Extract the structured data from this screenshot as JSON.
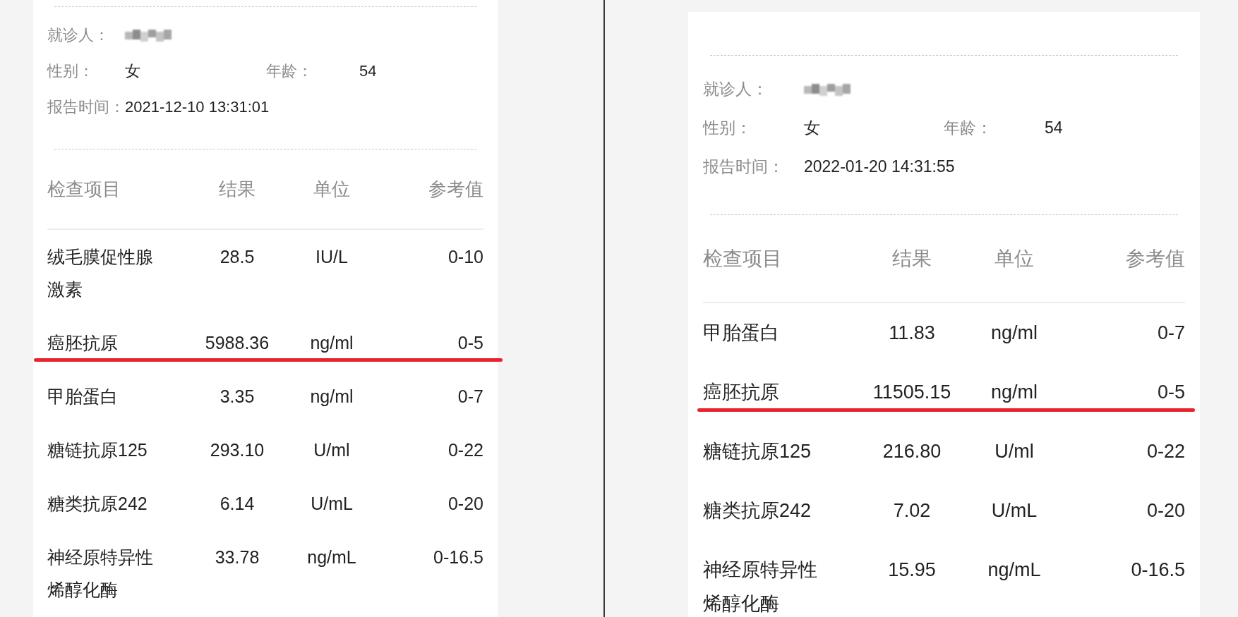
{
  "panels": [
    {
      "patient_label": "就诊人：",
      "sex_label": "性别：",
      "sex": "女",
      "age_label": "年龄：",
      "age": "54",
      "time_label": "报告时间：",
      "time": "2021-12-10 13:31:01",
      "columns": [
        "检查项目",
        "结果",
        "单位",
        "参考值"
      ],
      "rows": [
        {
          "item": "绒毛膜促性腺激素",
          "result": "28.5",
          "unit": "IU/L",
          "reference": "0-10",
          "underlined": false
        },
        {
          "item": "癌胚抗原",
          "result": "5988.36",
          "unit": "ng/ml",
          "reference": "0-5",
          "underlined": true
        },
        {
          "item": "甲胎蛋白",
          "result": "3.35",
          "unit": "ng/ml",
          "reference": "0-7",
          "underlined": false
        },
        {
          "item": "糖链抗原125",
          "result": "293.10",
          "unit": "U/ml",
          "reference": "0-22",
          "underlined": false
        },
        {
          "item": "糖类抗原242",
          "result": "6.14",
          "unit": "U/mL",
          "reference": "0-20",
          "underlined": false
        },
        {
          "item": "神经原特异性烯醇化酶",
          "result": "33.78",
          "unit": "ng/mL",
          "reference": "0-16.5",
          "underlined": false
        }
      ]
    },
    {
      "patient_label": "就诊人：",
      "sex_label": "性别：",
      "sex": "女",
      "age_label": "年龄：",
      "age": "54",
      "time_label": "报告时间：",
      "time": "2022-01-20 14:31:55",
      "columns": [
        "检查项目",
        "结果",
        "单位",
        "参考值"
      ],
      "rows": [
        {
          "item": "甲胎蛋白",
          "result": "11.83",
          "unit": "ng/ml",
          "reference": "0-7",
          "underlined": false
        },
        {
          "item": "癌胚抗原",
          "result": "11505.15",
          "unit": "ng/ml",
          "reference": "0-5",
          "underlined": true
        },
        {
          "item": "糖链抗原125",
          "result": "216.80",
          "unit": "U/ml",
          "reference": "0-22",
          "underlined": false
        },
        {
          "item": "糖类抗原242",
          "result": "7.02",
          "unit": "U/mL",
          "reference": "0-20",
          "underlined": false
        },
        {
          "item": "神经原特异性烯醇化酶",
          "result": "15.95",
          "unit": "ng/mL",
          "reference": "0-16.5",
          "underlined": false
        }
      ]
    }
  ]
}
